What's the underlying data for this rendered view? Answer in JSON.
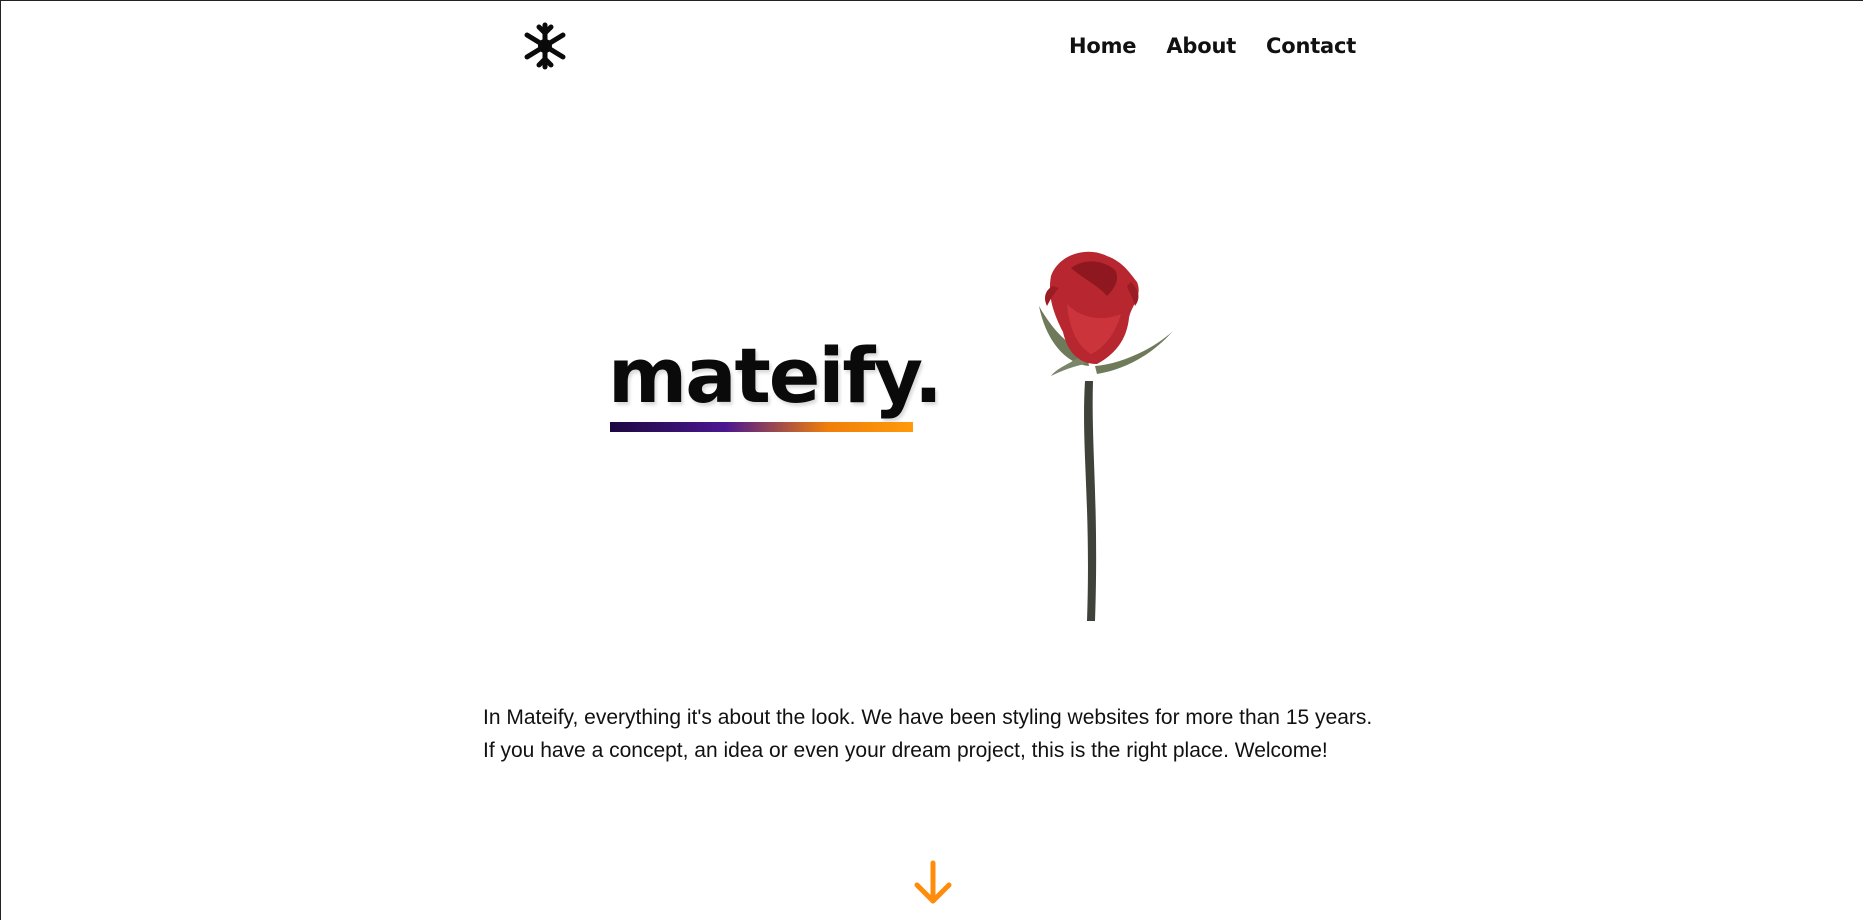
{
  "header": {
    "logo_icon": "snowflake-icon",
    "nav": [
      {
        "label": "Home"
      },
      {
        "label": "About"
      },
      {
        "label": "Contact"
      }
    ]
  },
  "hero": {
    "title": "mateify.",
    "underline_gradient": [
      "#1e0840",
      "#4a1690",
      "#f07f0a",
      "#ff9a0a"
    ],
    "image_icon": "red-rose-image"
  },
  "intro": {
    "text": "In Mateify, everything it's about the look. We have been styling websites for more than 15 years. If you have a concept, an idea or even your dream project, this is the right place. Welcome!"
  },
  "scroll": {
    "icon": "arrow-down-icon",
    "color": "#ff8c0a"
  }
}
